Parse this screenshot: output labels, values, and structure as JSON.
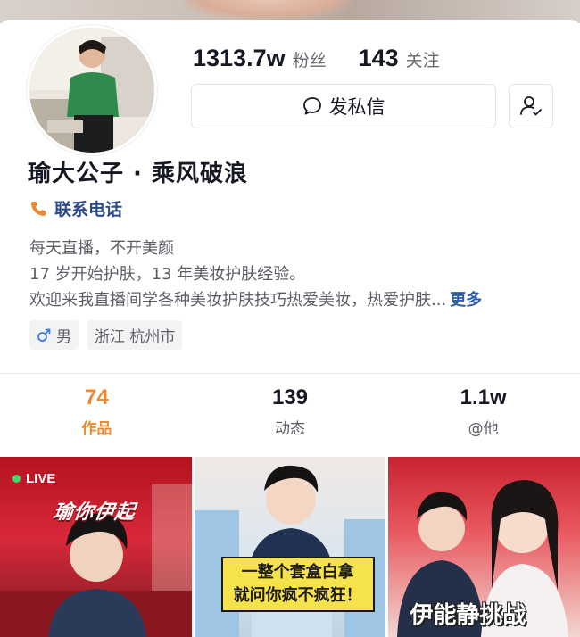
{
  "profile": {
    "followers_count": "1313.7w",
    "followers_label": "粉丝",
    "following_count": "143",
    "following_label": "关注",
    "message_button": "发私信",
    "nickname": "瑜大公子 · 乘风破浪",
    "contact_label": "联系电话",
    "bio_lines": [
      "每天直播，不开美颜",
      "17 岁开始护肤，13 年美妆护肤经验。",
      "欢迎来我直播间学各种美妆护肤技巧热爱美妆，热爱护肤..."
    ],
    "bio_more": "更多",
    "gender_tag": "男",
    "location_tag": "浙江 杭州市"
  },
  "tabs": [
    {
      "count": "74",
      "label": "作品",
      "active": true
    },
    {
      "count": "139",
      "label": "动态",
      "active": false
    },
    {
      "count": "1.1w",
      "label": "@他",
      "active": false
    }
  ],
  "videos": [
    {
      "badge": "LIVE",
      "title": "瑜你伊起"
    },
    {
      "caption_line1": "一整个套盒白拿",
      "caption_line2": "就问你疯不疯狂！"
    },
    {
      "caption": "伊能静挑战"
    }
  ],
  "icons": {
    "message": "chat-bubble-icon",
    "follow": "user-check-icon",
    "phone": "phone-icon",
    "gender": "male-icon"
  },
  "colors": {
    "accent_orange": "#f0882f",
    "link_blue": "#2b5fa8",
    "live_green": "#3ddc68",
    "caption_yellow": "#f6e24a"
  }
}
